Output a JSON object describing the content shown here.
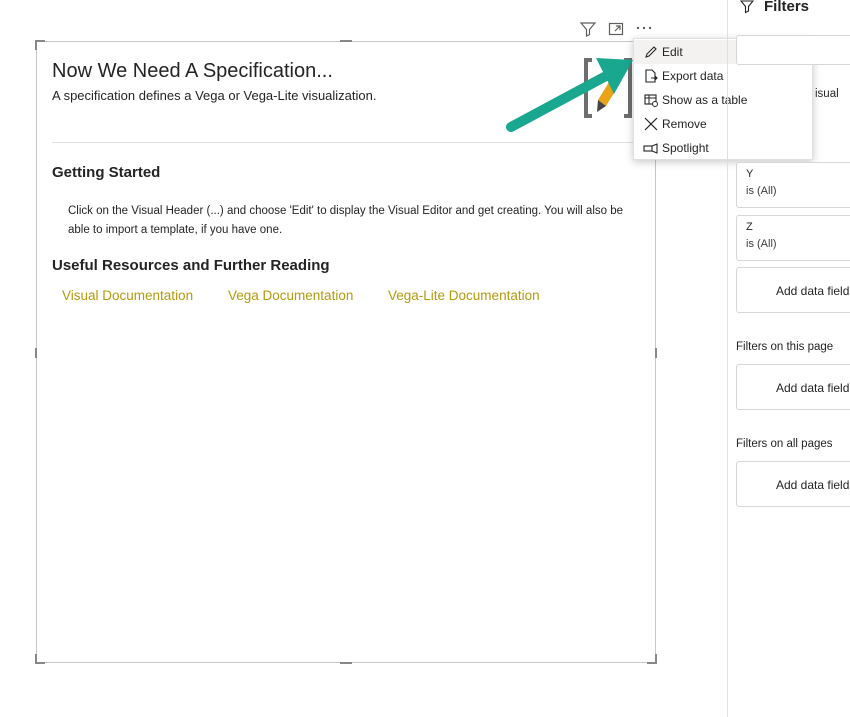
{
  "visual": {
    "title": "Now We Need A Specification...",
    "subtitle": "A specification defines a Vega or Vega-Lite visualization.",
    "getting_started_heading": "Getting Started",
    "getting_started_body": "Click on the Visual Header (...) and choose 'Edit' to display the Visual Editor and get creating. You will also be able to import a template, if you have one.",
    "resources_heading": "Useful Resources and Further Reading",
    "links": [
      "Visual Documentation",
      "Vega Documentation",
      "Vega-Lite Documentation"
    ],
    "link_color": "#b19a0c"
  },
  "header_icons": [
    "filter-icon",
    "focus-mode-icon",
    "more-options-icon"
  ],
  "context_menu": {
    "items": [
      {
        "label": "Edit",
        "icon": "pencil-icon",
        "highlighted": true
      },
      {
        "label": "Export data",
        "icon": "export-icon"
      },
      {
        "label": "Show as a table",
        "icon": "table-icon"
      },
      {
        "label": "Remove",
        "icon": "close-icon"
      },
      {
        "label": "Spotlight",
        "icon": "spotlight-icon"
      }
    ]
  },
  "filters": {
    "heading": "Filters",
    "partial_visual_label": "isual",
    "cards": [
      {
        "name": "Y",
        "value": "is (All)"
      },
      {
        "name": "Z",
        "value": "is (All)"
      }
    ],
    "add_field_label": "Add data field",
    "this_page_label": "Filters on this page",
    "all_pages_label": "Filters on all pages"
  },
  "colors": {
    "arrow": "#1aa78f",
    "logo_bracket": "#6e6e6e",
    "logo_pencil": "#e8a317"
  }
}
